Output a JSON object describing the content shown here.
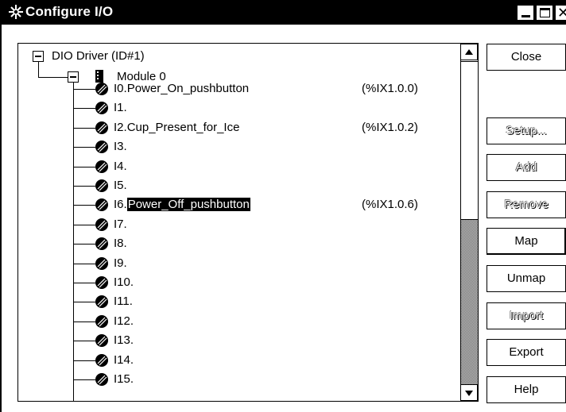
{
  "window": {
    "title": "Configure I/O",
    "icon": "io-config-icon",
    "controls": {
      "minimize": "minimize-icon",
      "maximize": "maximize-icon",
      "close": "close-icon"
    }
  },
  "tree": {
    "driver": {
      "label": "DIO Driver (ID#1)"
    },
    "module": {
      "label": "Module 0"
    },
    "points": [
      {
        "prefix": "I0.",
        "name": "Power_On_pushbutton",
        "address": "(%IX1.0.0)",
        "selected": false
      },
      {
        "prefix": "I1.",
        "name": "",
        "address": "",
        "selected": false
      },
      {
        "prefix": "I2.",
        "name": "Cup_Present_for_Ice",
        "address": "(%IX1.0.2)",
        "selected": false
      },
      {
        "prefix": "I3.",
        "name": "",
        "address": "",
        "selected": false
      },
      {
        "prefix": "I4.",
        "name": "",
        "address": "",
        "selected": false
      },
      {
        "prefix": "I5.",
        "name": "",
        "address": "",
        "selected": false
      },
      {
        "prefix": "I6.",
        "name": "Power_Off_pushbutton",
        "address": "(%IX1.0.6)",
        "selected": true
      },
      {
        "prefix": "I7.",
        "name": "",
        "address": "",
        "selected": false
      },
      {
        "prefix": "I8.",
        "name": "",
        "address": "",
        "selected": false
      },
      {
        "prefix": "I9.",
        "name": "",
        "address": "",
        "selected": false
      },
      {
        "prefix": "I10.",
        "name": "",
        "address": "",
        "selected": false
      },
      {
        "prefix": "I11.",
        "name": "",
        "address": "",
        "selected": false
      },
      {
        "prefix": "I12.",
        "name": "",
        "address": "",
        "selected": false
      },
      {
        "prefix": "I13.",
        "name": "",
        "address": "",
        "selected": false
      },
      {
        "prefix": "I14.",
        "name": "",
        "address": "",
        "selected": false
      },
      {
        "prefix": "I15.",
        "name": "",
        "address": "",
        "selected": false
      }
    ]
  },
  "buttons": {
    "close": {
      "label": "Close",
      "enabled": true
    },
    "setup": {
      "label": "Setup...",
      "enabled": false
    },
    "add": {
      "label": "Add",
      "enabled": false
    },
    "remove": {
      "label": "Remove",
      "enabled": false
    },
    "map": {
      "label": "Map",
      "enabled": true
    },
    "unmap": {
      "label": "Unmap",
      "enabled": true
    },
    "import": {
      "label": "Import",
      "enabled": false
    },
    "export": {
      "label": "Export",
      "enabled": true
    },
    "help": {
      "label": "Help",
      "enabled": true
    }
  }
}
